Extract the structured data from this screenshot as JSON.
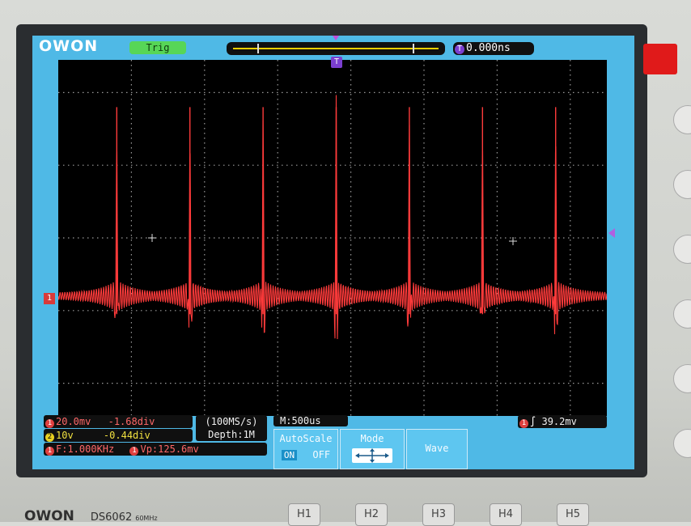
{
  "brand_logo": "OWON",
  "top": {
    "trigger_status": "Trig",
    "time_offset": "0.000ns",
    "t_badge": "T"
  },
  "channel_marker": "1",
  "ch1": {
    "scale": "20.0mv",
    "offset": "-1.68div",
    "frequency": "F:1.000KHz",
    "vpp": "Vp:125.6mv",
    "color": "#ff3b3b"
  },
  "ch2": {
    "scale": "10v",
    "offset": "-0.44div",
    "color": "#f0e040"
  },
  "acquisition": {
    "sample_rate": "(100MS/s)",
    "depth": "Depth:1M"
  },
  "timebase": "M:500us",
  "trigger_readout": "39.2mv",
  "menu": {
    "autoscale_label": "AutoScale",
    "autoscale_on": "ON",
    "autoscale_off": "OFF",
    "mode_label": "Mode",
    "wave_label": "Wave"
  },
  "front_panel": {
    "brand": "OWON",
    "model": "DS6062",
    "bandwidth": "60MHz",
    "buttons": [
      "H1",
      "H2",
      "H3",
      "H4",
      "H5"
    ]
  },
  "chart_data": {
    "type": "line",
    "series": [
      {
        "pulse_x_div": [
          0.8,
          1.8,
          2.8,
          3.8,
          4.8,
          5.8,
          6.8
        ],
        "pulse_amplitude_div": 2.6,
        "baseline_div": -0.8,
        "waveform_style": "periodic damped ringing burst at each pulse"
      }
    ],
    "x_divisions": 7.5,
    "y_divisions": 4.9,
    "grid": true
  }
}
